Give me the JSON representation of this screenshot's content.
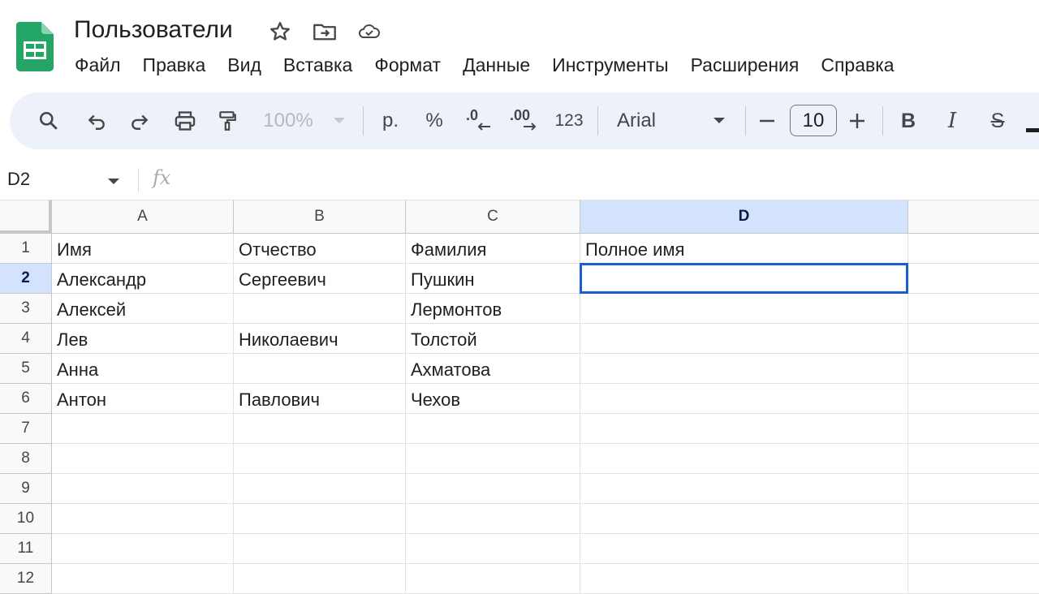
{
  "app": {
    "document_title": "Пользователи",
    "icons": [
      "sheets-logo-icon",
      "star-icon",
      "move-to-folder-icon",
      "cloud-saved-icon"
    ]
  },
  "menu": [
    "Файл",
    "Правка",
    "Вид",
    "Вставка",
    "Формат",
    "Данные",
    "Инструменты",
    "Расширения",
    "Справка"
  ],
  "toolbar": {
    "zoom": "100%",
    "currency": "р.",
    "percent": "%",
    "decrease_decimal": ".0",
    "increase_decimal": ".00",
    "more_formats": "123",
    "font": "Arial",
    "font_size": "10",
    "bold": "B",
    "italic": "I",
    "strikethrough": "S"
  },
  "formula_bar": {
    "name_box": "D2",
    "fx": "fx",
    "formula": ""
  },
  "sheet": {
    "columns": [
      "A",
      "B",
      "C",
      "D"
    ],
    "selected_column": "D",
    "rows": [
      "1",
      "2",
      "3",
      "4",
      "5",
      "6",
      "7",
      "8",
      "9",
      "10",
      "11",
      "12"
    ],
    "selected_row": "2",
    "cells": [
      [
        "Имя",
        "Отчество",
        "Фамилия",
        "Полное имя"
      ],
      [
        "Александр",
        "Сергеевич",
        "Пушкин",
        ""
      ],
      [
        "Алексей",
        "",
        "Лермонтов",
        ""
      ],
      [
        "Лев",
        "Николаевич",
        "Толстой",
        ""
      ],
      [
        "Анна",
        "",
        "Ахматова",
        ""
      ],
      [
        "Антон",
        "Павлович",
        "Чехов",
        ""
      ]
    ]
  }
}
